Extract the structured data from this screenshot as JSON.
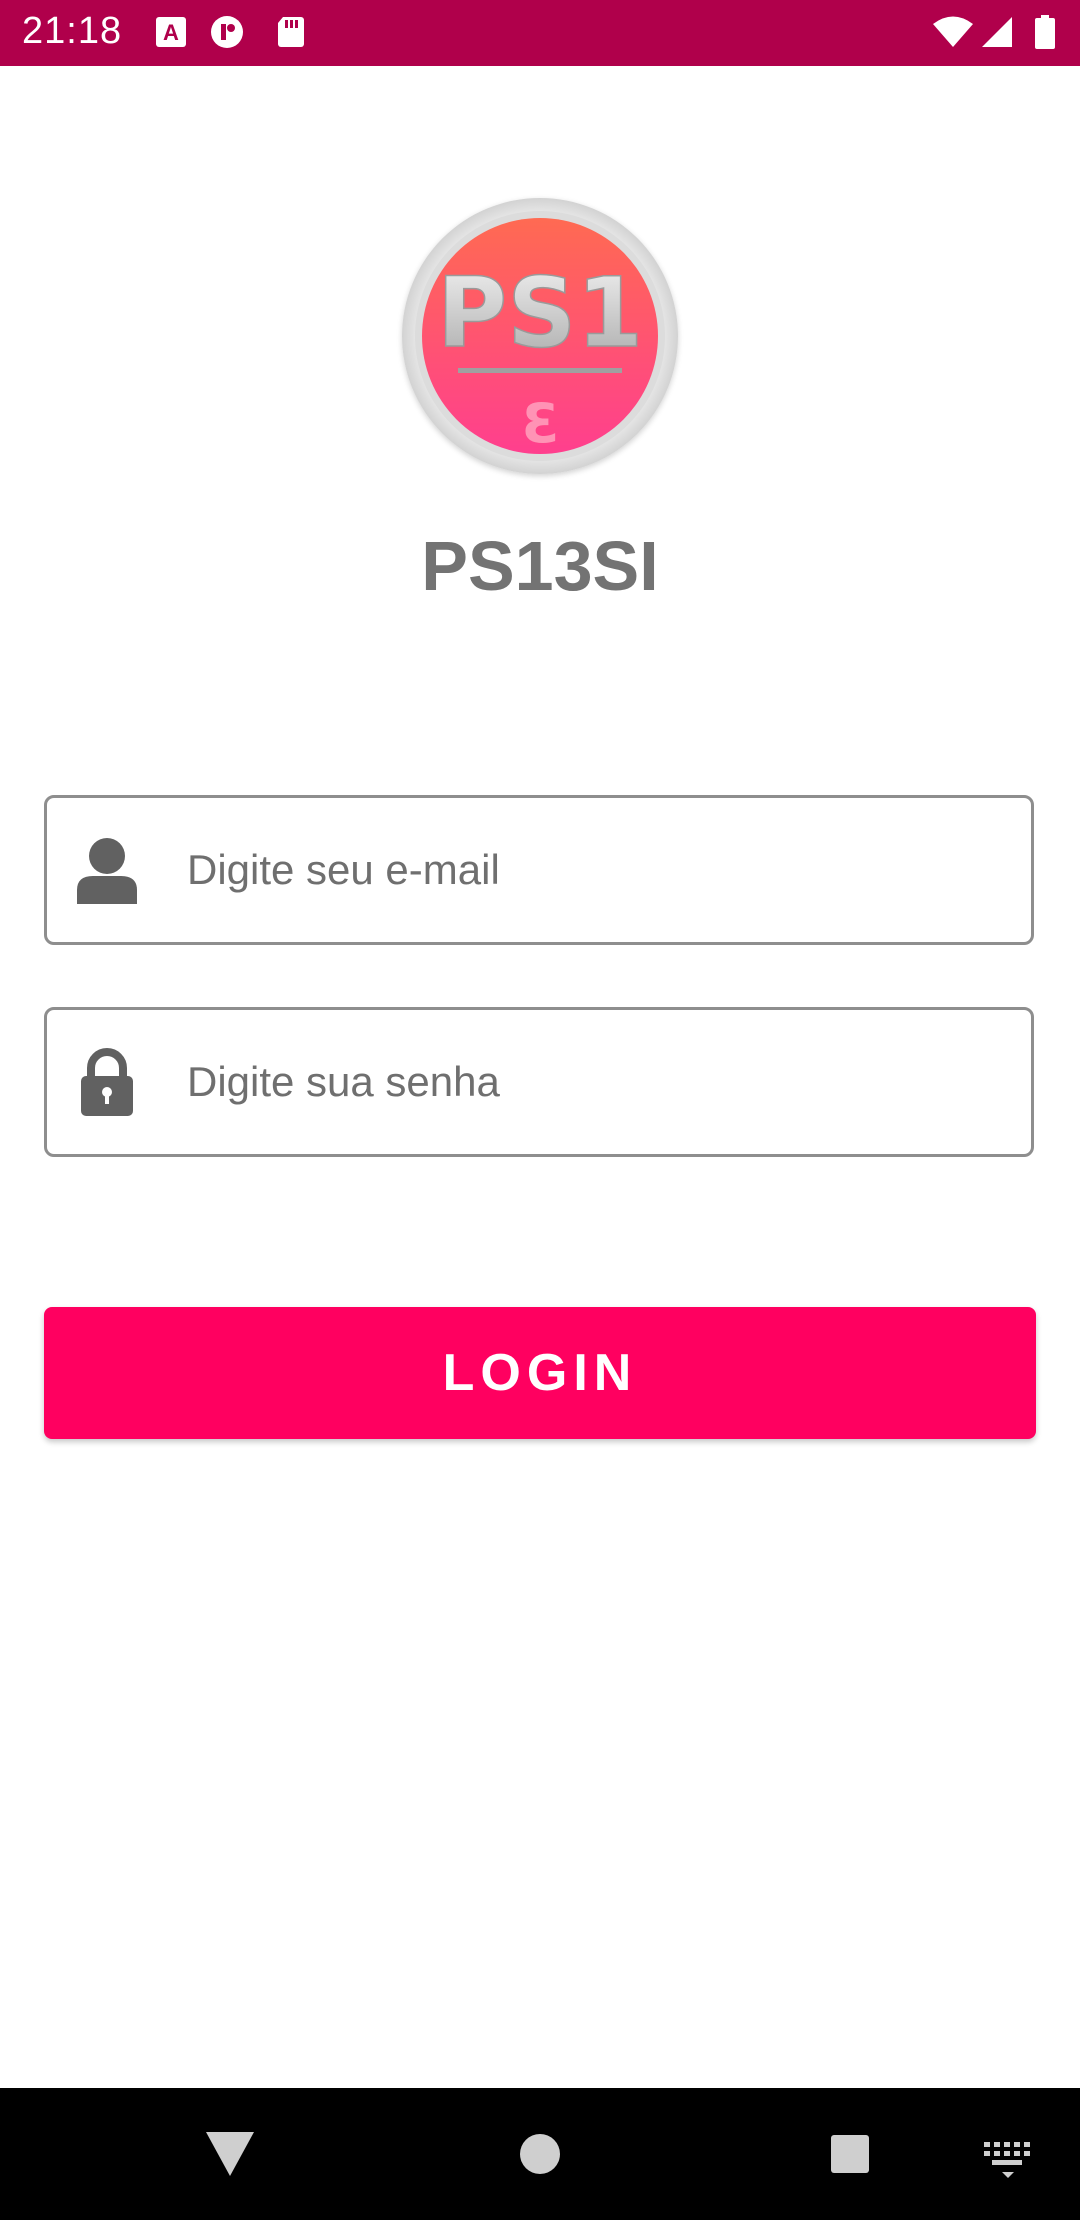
{
  "status_bar": {
    "time": "21:18",
    "icons": [
      "a-notification-icon",
      "vpn-key-icon",
      "sd-card-icon",
      "wifi-icon",
      "signal-icon",
      "battery-icon"
    ],
    "background": "#b0004b"
  },
  "logo": {
    "text_top": "PS1",
    "text_bottom": "3",
    "colors": {
      "ring": "#d6d6d6",
      "fill_top": "#ff6f5a",
      "fill_bottom": "#ff3d8a",
      "text": "#c9c9c9"
    }
  },
  "app_title": "PS13SI",
  "form": {
    "email": {
      "placeholder": "Digite seu e-mail",
      "value": "",
      "icon": "user-icon"
    },
    "password": {
      "placeholder": "Digite sua senha",
      "value": "",
      "icon": "lock-icon"
    }
  },
  "login_button": {
    "label": "LOGIN",
    "color": "#ff0060"
  },
  "nav_bar": {
    "items": [
      "back-icon",
      "home-icon",
      "recents-icon",
      "keyboard-icon"
    ],
    "background": "#000000"
  }
}
